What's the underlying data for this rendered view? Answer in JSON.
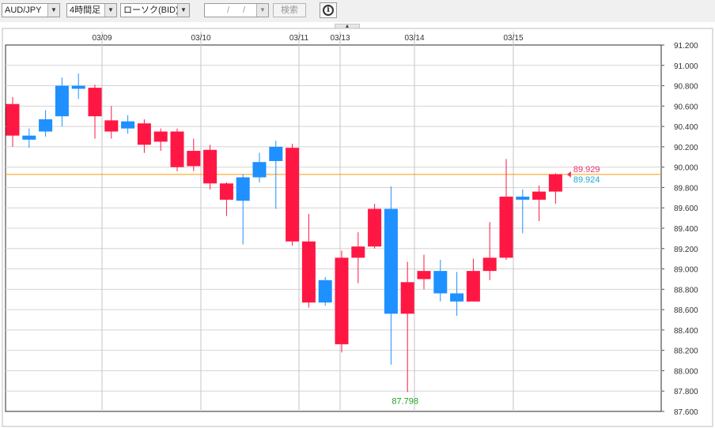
{
  "toolbar": {
    "pair": "AUD/JPY",
    "timeframe": "4時間足",
    "chart_style": "ローソク(BID)",
    "date_placeholder_sep": "/",
    "search_label": "検索",
    "info_icon": "info-icon",
    "dropdown_icon": "▼"
  },
  "colors": {
    "bull": "#ff1744",
    "bear": "#1e90ff",
    "last_line": "#ff9800",
    "bid_label": "#e8336d",
    "ask_label": "#1ea7d2",
    "low_label": "#22a020"
  },
  "chart_data": {
    "type": "candlestick",
    "date_labels": [
      "03/09",
      "03/10",
      "03/11",
      "03/13",
      "03/14",
      "03/15"
    ],
    "y_ticks": [
      "91.200",
      "91.000",
      "90.800",
      "90.600",
      "90.400",
      "90.200",
      "90.000",
      "89.800",
      "89.600",
      "89.400",
      "89.200",
      "89.000",
      "88.800",
      "88.600",
      "88.400",
      "88.200",
      "88.000",
      "87.800",
      "87.600"
    ],
    "ylim": [
      87.6,
      91.2
    ],
    "current_bid": "89.929",
    "current_ask": "89.924",
    "low_label": "87.798",
    "candles": [
      {
        "o": 90.31,
        "h": 90.69,
        "l": 90.2,
        "c": 90.62
      },
      {
        "o": 90.31,
        "h": 90.38,
        "l": 90.19,
        "c": 90.27
      },
      {
        "o": 90.47,
        "h": 90.56,
        "l": 90.3,
        "c": 90.35
      },
      {
        "o": 90.8,
        "h": 90.88,
        "l": 90.4,
        "c": 90.5
      },
      {
        "o": 90.8,
        "h": 90.92,
        "l": 90.67,
        "c": 90.77
      },
      {
        "o": 90.5,
        "h": 90.81,
        "l": 90.28,
        "c": 90.78
      },
      {
        "o": 90.35,
        "h": 90.6,
        "l": 90.28,
        "c": 90.46
      },
      {
        "o": 90.45,
        "h": 90.51,
        "l": 90.33,
        "c": 90.38
      },
      {
        "o": 90.22,
        "h": 90.47,
        "l": 90.14,
        "c": 90.43
      },
      {
        "o": 90.25,
        "h": 90.38,
        "l": 90.16,
        "c": 90.35
      },
      {
        "o": 90.0,
        "h": 90.38,
        "l": 89.96,
        "c": 90.35
      },
      {
        "o": 90.01,
        "h": 90.28,
        "l": 89.96,
        "c": 90.16
      },
      {
        "o": 89.84,
        "h": 90.22,
        "l": 89.78,
        "c": 90.17
      },
      {
        "o": 89.68,
        "h": 89.85,
        "l": 89.52,
        "c": 89.84
      },
      {
        "o": 89.9,
        "h": 89.93,
        "l": 89.24,
        "c": 89.67
      },
      {
        "o": 90.05,
        "h": 90.14,
        "l": 89.85,
        "c": 89.9
      },
      {
        "o": 90.2,
        "h": 90.26,
        "l": 89.59,
        "c": 90.06
      },
      {
        "o": 89.27,
        "h": 90.23,
        "l": 89.23,
        "c": 90.19
      },
      {
        "o": 88.67,
        "h": 89.54,
        "l": 88.62,
        "c": 89.27
      },
      {
        "o": 88.89,
        "h": 88.92,
        "l": 88.64,
        "c": 88.67
      },
      {
        "o": 88.26,
        "h": 89.18,
        "l": 88.18,
        "c": 89.11
      },
      {
        "o": 89.11,
        "h": 89.36,
        "l": 88.86,
        "c": 89.22
      },
      {
        "o": 89.22,
        "h": 89.64,
        "l": 89.2,
        "c": 89.59
      },
      {
        "o": 89.59,
        "h": 89.81,
        "l": 88.06,
        "c": 88.56
      },
      {
        "o": 88.56,
        "h": 89.07,
        "l": 87.79,
        "c": 88.87
      },
      {
        "o": 88.9,
        "h": 89.14,
        "l": 88.8,
        "c": 88.98
      },
      {
        "o": 88.98,
        "h": 89.09,
        "l": 88.68,
        "c": 88.76
      },
      {
        "o": 88.76,
        "h": 88.97,
        "l": 88.54,
        "c": 88.68
      },
      {
        "o": 88.68,
        "h": 89.1,
        "l": 88.68,
        "c": 88.98
      },
      {
        "o": 88.98,
        "h": 89.46,
        "l": 88.89,
        "c": 89.11
      },
      {
        "o": 89.11,
        "h": 90.08,
        "l": 89.09,
        "c": 89.71
      },
      {
        "o": 89.71,
        "h": 89.78,
        "l": 89.35,
        "c": 89.68
      },
      {
        "o": 89.68,
        "h": 89.82,
        "l": 89.47,
        "c": 89.76
      },
      {
        "o": 89.76,
        "h": 89.94,
        "l": 89.64,
        "c": 89.93
      }
    ]
  }
}
